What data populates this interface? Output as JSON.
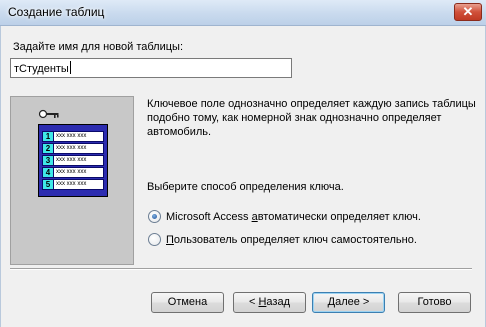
{
  "window": {
    "title": "Создание таблиц",
    "background_title": "",
    "close_glyph": "✕"
  },
  "form": {
    "prompt_label": "Задайте имя для новой таблицы:",
    "table_name_value": "тСтуденты"
  },
  "illustration": {
    "icon": "key-icon",
    "rows": [
      {
        "num": "1",
        "cells": "xxx xxx xxx"
      },
      {
        "num": "2",
        "cells": "xxx xxx xxx"
      },
      {
        "num": "3",
        "cells": "xxx xxx xxx"
      },
      {
        "num": "4",
        "cells": "xxx xxx xxx"
      },
      {
        "num": "5",
        "cells": "xxx xxx xxx"
      }
    ]
  },
  "description": "Ключевое поле однозначно определяет каждую запись таблицы подобно тому, как номерной знак однозначно определяет автомобиль.",
  "key_method": {
    "label": "Выберите способ определения ключа.",
    "options": [
      {
        "prefix": "Microsoft Access ",
        "accel": "а",
        "rest": "втоматически определяет ключ.",
        "checked": true
      },
      {
        "prefix": "",
        "accel": "П",
        "rest": "ользователь определяет ключ самостоятельно.",
        "checked": false
      }
    ]
  },
  "buttons": {
    "cancel": "Отмена",
    "back_prefix": "< ",
    "back_accel": "Н",
    "back_rest": "азад",
    "next_accel": "Д",
    "next_rest": "алее >",
    "done": "Готово"
  },
  "colors": {
    "titlebar": "#c9daee",
    "dialog_bg": "#f0f0f0",
    "illustration_bg": "#c8c8c8",
    "table_frame": "#2c2cb0",
    "row_number_bg": "#3fe8e8",
    "default_button_border": "#3c7fb1"
  }
}
